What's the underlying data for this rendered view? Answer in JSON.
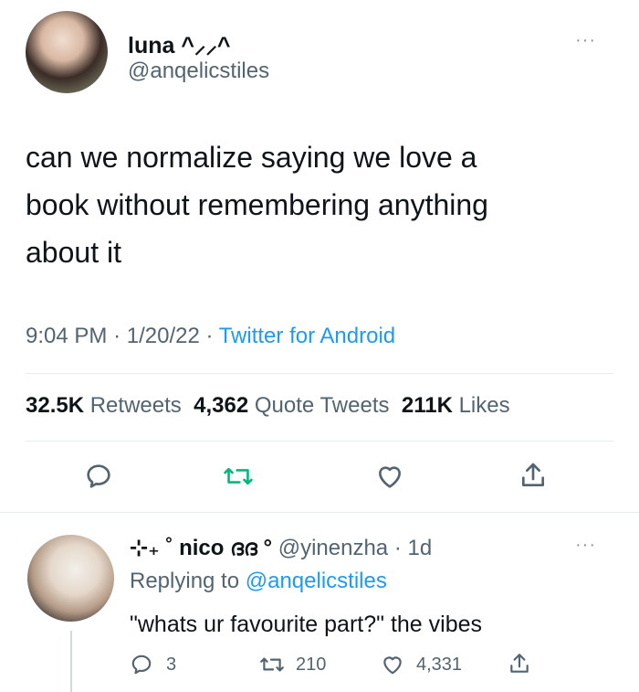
{
  "tweet": {
    "display_name": "luna ^⸝⸝^",
    "handle": "@anqelicstiles",
    "more": "···",
    "text_lines": [
      "can we normalize saying we love a",
      "book without remembering anything",
      "about it"
    ],
    "time": "9:04 PM",
    "date": "1/20/22",
    "source": "Twitter for Android",
    "sep": "·",
    "stats": {
      "retweets_count": "32.5K",
      "retweets_label": "Retweets",
      "quotes_count": "4,362",
      "quotes_label": "Quote Tweets",
      "likes_count": "211K",
      "likes_label": "Likes"
    }
  },
  "reply": {
    "display_name": "⊹₊ ˚ nico ദദ °",
    "handle": "@yinenzha",
    "age": "1d",
    "replying_prefix": "Replying to",
    "replying_to": "@anqelicstiles",
    "text": "\"whats ur favourite part?\" the vibes",
    "counts": {
      "replies": "3",
      "retweets": "210",
      "likes": "4,331"
    },
    "more": "···"
  },
  "icons": [
    "reply-icon",
    "retweet-icon",
    "like-icon",
    "share-icon"
  ],
  "colors": {
    "link": "#1d9bf0",
    "secondary": "#536471",
    "primary": "#0f1419"
  }
}
